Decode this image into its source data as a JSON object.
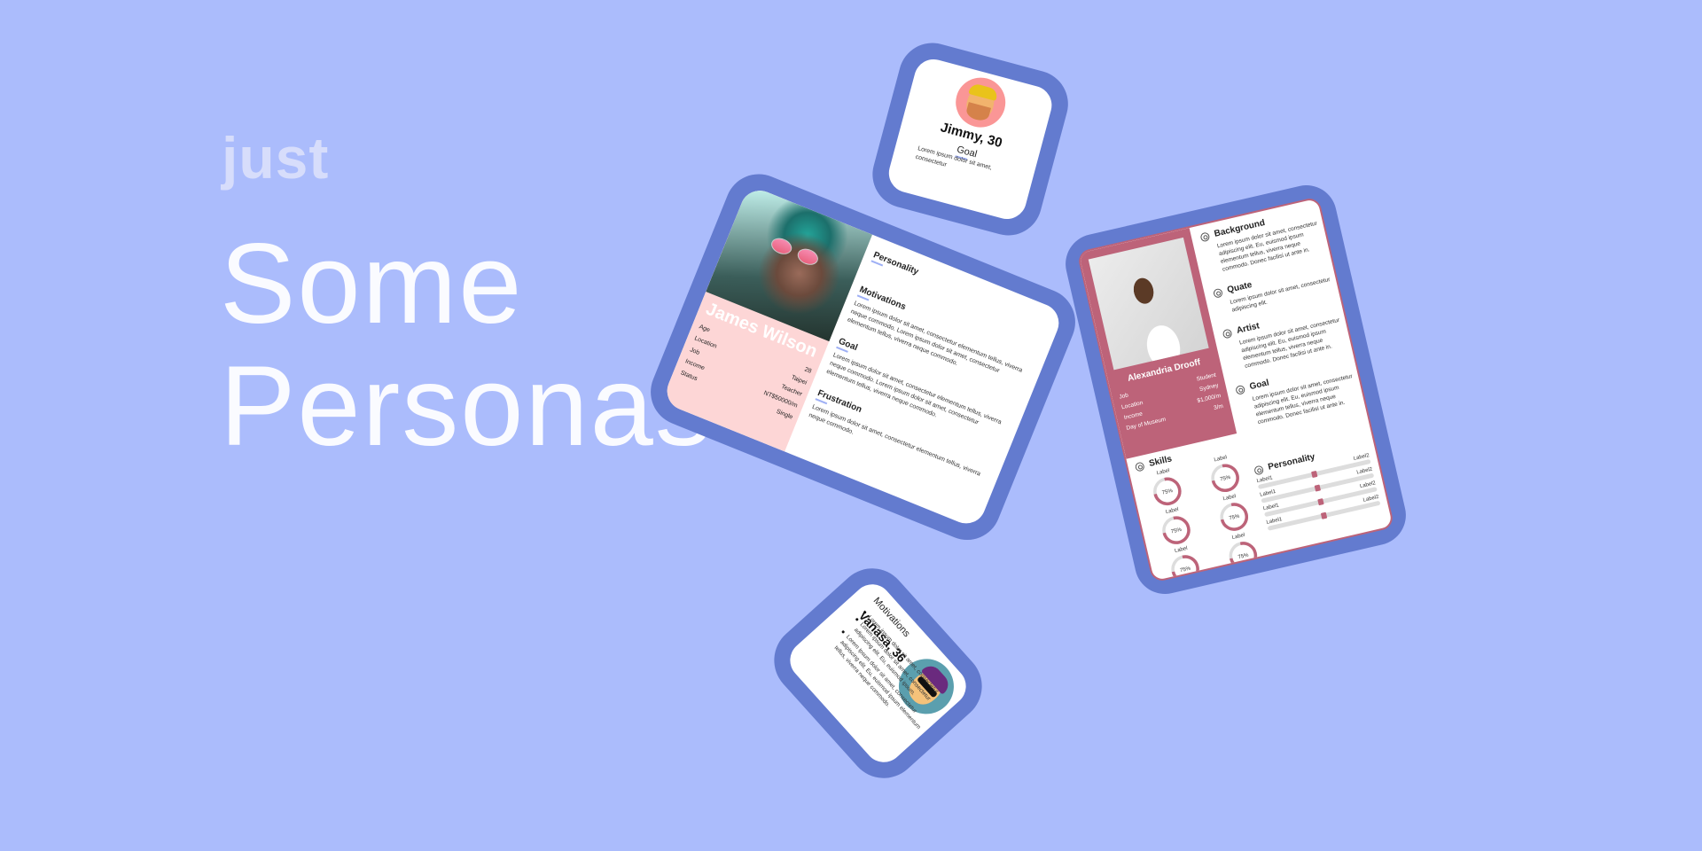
{
  "hero": {
    "kicker": "just",
    "line1": "Some",
    "line2": "Personas"
  },
  "colors": {
    "background": "#abbcfc",
    "frame": "#637bcf",
    "accent": "#bd6379",
    "pink_panel": "#fdd6d6"
  },
  "james": {
    "name": "James Wilson",
    "fields": [
      {
        "label": "Age",
        "value": "28"
      },
      {
        "label": "Location",
        "value": "Taipei"
      },
      {
        "label": "Job",
        "value": "Teacher"
      },
      {
        "label": "Income",
        "value": "NT$50000/m"
      },
      {
        "label": "Status",
        "value": "Single"
      }
    ],
    "sections": [
      {
        "title": "Personality",
        "text": ""
      },
      {
        "title": "Motivations",
        "text": "Lorem ipsum dolor sit amet, consectetur elementum tellus, viverra neque commodo. Lorem ipsum dolor sit amet, consectetur elementum tellus, viverra neque commodo."
      },
      {
        "title": "Goal",
        "text": "Lorem ipsum dolor sit amet, consectetur elementum tellus, viverra neque commodo. Lorem ipsum dolor sit amet, consectetur elementum tellus, viverra neque commodo."
      },
      {
        "title": "Frustration",
        "text": "Lorem ipsum dolor sit amet, consectetur elementum tellus, viverra neque commodo."
      }
    ]
  },
  "jimmy": {
    "name": "Jimmy, 30",
    "section": "Goal",
    "text": "Lorem ipsum dolor sit amet, consectetur"
  },
  "vanasa": {
    "name": "Vanasa, 36",
    "section": "Motivations",
    "bullets": [
      "Lorem ipsum dolor sit amet, consectetur.",
      "Lorem ipsum dolor sit amet, consectetur adipiscing elit. Eu, euismod ipsum.",
      "Lorem ipsum dolor sit amet, consectetur adipiscing elit. Eu, euismod ipsum elementum tellus, viverra neque commodo."
    ]
  },
  "alexandria": {
    "name": "Alexandria Drooff",
    "fields": [
      {
        "label": "Job",
        "value": "Student"
      },
      {
        "label": "Location",
        "value": "Sydney"
      },
      {
        "label": "Income",
        "value": "$1,000/m"
      },
      {
        "label": "Day of Museum",
        "value": "3/m"
      }
    ],
    "sections": [
      {
        "title": "Background",
        "text": "Lorem ipsum dolor sit amet, consectetur adipiscing elit. Eu, euismod ipsum elementum tellus, viverra neque commodo. Donec facilisi ut ante in."
      },
      {
        "title": "Quate",
        "text": "Lorem ipsum dolor sit amet, consectetur adipiscing elit."
      },
      {
        "title": "Artist",
        "text": "Lorem ipsum dolor sit amet, consectetur adipiscing elit. Eu, euismod ipsum elementum tellus, viverra neque commodo. Donec facilisi ut ante in."
      },
      {
        "title": "Goal",
        "text": "Lorem ipsum dolor sit amet, consectetur adipiscing elit. Eu, euismod ipsum elementum tellus, viverra neque commodo. Donec facilisi ut ante in."
      }
    ],
    "skills": {
      "title": "Skills",
      "items": [
        {
          "label": "Label",
          "percent": 75,
          "text": "75%"
        },
        {
          "label": "Label",
          "percent": 75,
          "text": "75%"
        },
        {
          "label": "Label",
          "percent": 75,
          "text": "75%"
        },
        {
          "label": "Label",
          "percent": 75,
          "text": "75%"
        },
        {
          "label": "Label",
          "percent": 75,
          "text": "75%"
        },
        {
          "label": "Label",
          "percent": 75,
          "text": "75%"
        }
      ]
    },
    "personality": {
      "title": "Personality",
      "sliders": [
        {
          "left": "Label1",
          "right": "Label2",
          "value": 0.5
        },
        {
          "left": "Label1",
          "right": "Label2",
          "value": 0.5
        },
        {
          "left": "Label1",
          "right": "Label2",
          "value": 0.5
        },
        {
          "left": "Label1",
          "right": "Label2",
          "value": 0.5
        }
      ]
    }
  }
}
